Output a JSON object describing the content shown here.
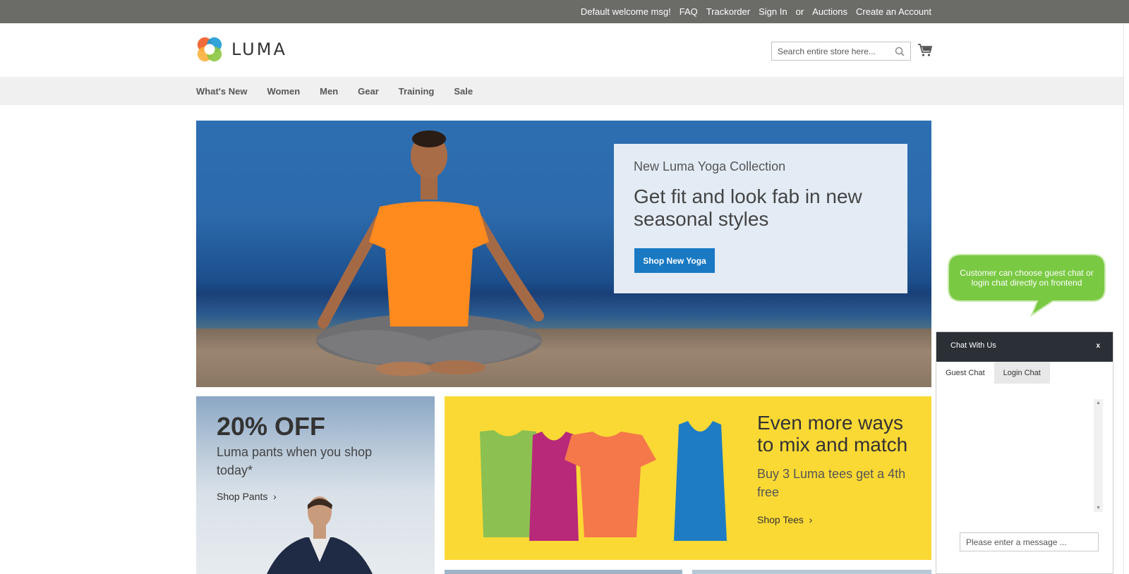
{
  "topbar": {
    "welcome": "Default welcome msg!",
    "links": [
      "FAQ",
      "Trackorder",
      "Sign In",
      "or",
      "Auctions",
      "Create an Account"
    ]
  },
  "header": {
    "logo_text": "LUMA",
    "search_placeholder": "Search entire store here..."
  },
  "nav": {
    "items": [
      "What's New",
      "Women",
      "Men",
      "Gear",
      "Training",
      "Sale"
    ]
  },
  "hero": {
    "subtitle": "New Luma Yoga Collection",
    "title": "Get fit and look fab in new seasonal styles",
    "button": "Shop New Yoga"
  },
  "promo_pants": {
    "headline": "20% OFF",
    "text": "Luma pants when you shop today*",
    "link": "Shop Pants"
  },
  "promo_tees": {
    "headline": "Even more ways to mix and match",
    "text": "Buy 3 Luma tees get a 4th free",
    "link": "Shop Tees"
  },
  "callout": {
    "text": "Customer can choose guest chat or login chat directly on frontend"
  },
  "chat": {
    "title": "Chat With Us",
    "close": "x",
    "tabs": [
      "Guest Chat",
      "Login Chat"
    ],
    "input_placeholder": "Please enter a message ..."
  },
  "colors": {
    "topbar": "#6b6b68",
    "accent_button": "#1979c3",
    "tees_bg": "#fbd934",
    "callout": "#7ac943",
    "chat_header": "#2b3037"
  }
}
